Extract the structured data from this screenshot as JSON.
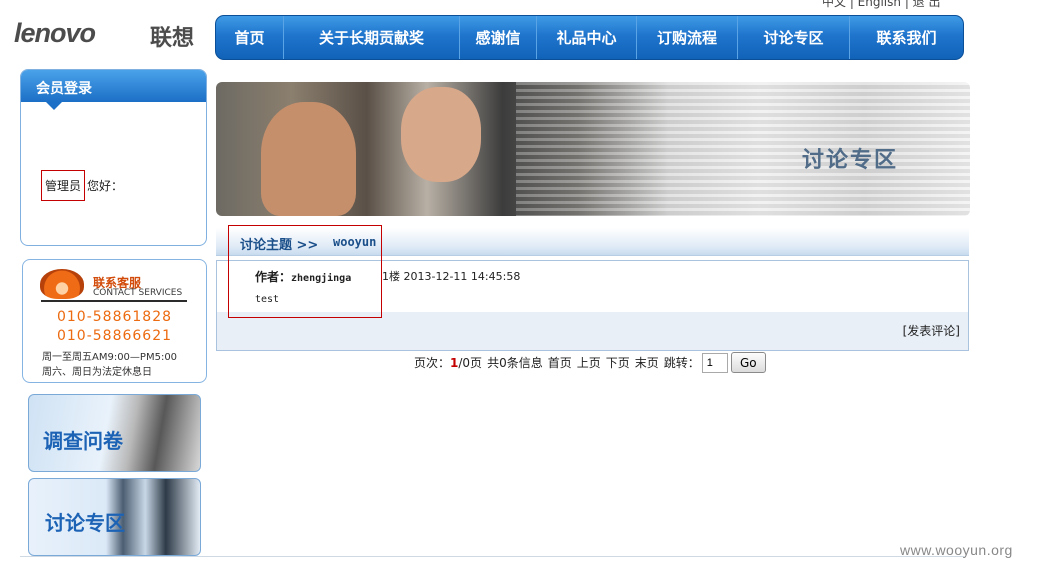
{
  "top_links": {
    "text": "中文 | English | 退 出"
  },
  "logo": {
    "en": "lenovo",
    "cn": "联想"
  },
  "nav": {
    "items": [
      {
        "label": "首页"
      },
      {
        "label": "关于长期贡献奖"
      },
      {
        "label": "感谢信"
      },
      {
        "label": "礼品中心"
      },
      {
        "label": "订购流程"
      },
      {
        "label": "讨论专区"
      },
      {
        "label": "联系我们"
      }
    ]
  },
  "login": {
    "title": "会员登录",
    "username": "管理员",
    "greeting": "您好："
  },
  "contact": {
    "title_cn": "联系客服",
    "title_en": "CONTACT SERVICES",
    "phone1": "010-58861828",
    "phone2": "010-58866621",
    "hours1": "周一至周五AM9:00—PM5:00",
    "hours2": "周六、周日为法定休息日"
  },
  "side_banners": {
    "survey": "调查问卷",
    "forum": "讨论专区"
  },
  "hero": {
    "title": "讨论专区"
  },
  "topic": {
    "label": "讨论主题 >>",
    "name": "wooyun"
  },
  "post": {
    "author_label": "作者：",
    "author": "zhengjinga",
    "floor": "1楼 2013-12-11 14:45:58",
    "content": "test",
    "comment_link": "[发表评论]"
  },
  "pager": {
    "prefix": "页次：",
    "current": "1",
    "total": "/0页",
    "info": "共0条信息",
    "first": "首页",
    "prev": "上页",
    "next": "下页",
    "last": "末页",
    "jump_label": "跳转：",
    "jump_value": "1",
    "go": "Go"
  },
  "watermark": "www.wooyun.org"
}
